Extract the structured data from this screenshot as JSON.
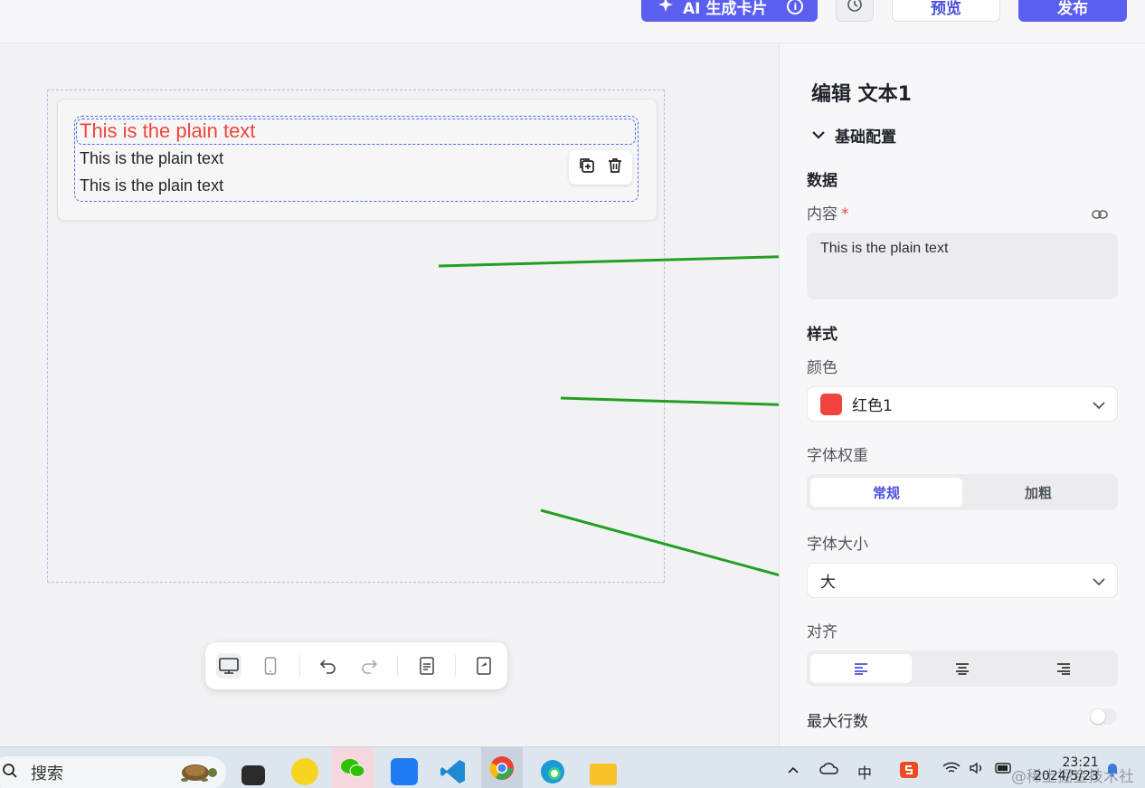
{
  "header": {
    "ai_button_label": "AI 生成卡片",
    "ai_info_glyph": "i",
    "history_icon": "history-icon",
    "preview_label": "预览",
    "publish_label": "发布"
  },
  "canvas": {
    "red_text": "This is the plain text",
    "plain_text_1": "This is the plain text",
    "plain_text_2": "This is the plain text",
    "tools": [
      "copy-add-icon",
      "trash-icon"
    ]
  },
  "bottom_toolbar": {
    "items": [
      "desktop-view-icon",
      "mobile-view-icon",
      "undo-icon",
      "redo-icon",
      "document-icon",
      "card-export-icon"
    ]
  },
  "panel": {
    "title": "编辑 文本1",
    "section": "基础配置",
    "data_group": "数据",
    "content_label": "内容",
    "required_mark": "*",
    "content_value": "This is the plain text",
    "style_group": "样式",
    "color_label": "颜色",
    "color_value": "红色1",
    "color_hex": "#f0443c",
    "weight_label": "字体权重",
    "weight_options": [
      "常规",
      "加粗"
    ],
    "weight_selected": "常规",
    "size_label": "字体大小",
    "size_value": "大",
    "align_label": "对齐",
    "align_options": [
      "align-left-icon",
      "align-center-icon",
      "align-right-icon"
    ],
    "align_selected": "align-left-icon",
    "max_lines_label": "最大行数",
    "max_lines_enabled": false
  },
  "taskbar": {
    "search_label": "搜索",
    "ime_label": "中",
    "time": "23:21",
    "date": "2024/5/23",
    "watermark": "@稀土掘金技术社区"
  },
  "colors": {
    "accent": "#5b5ff0",
    "arrow": "#22a022"
  }
}
